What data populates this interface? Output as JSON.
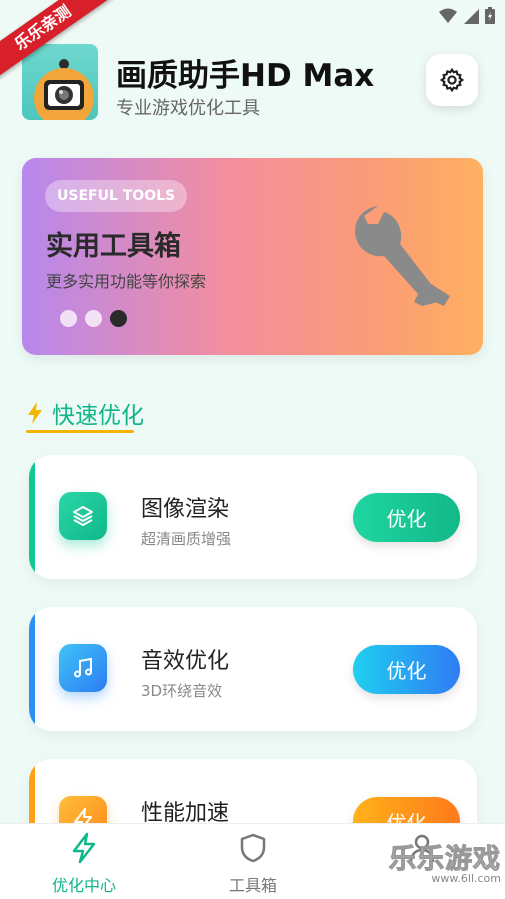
{
  "status_bar": {
    "icons": [
      "wifi-icon",
      "signal-icon",
      "battery-icon"
    ]
  },
  "watermark_ribbon": {
    "text": "乐乐亲测"
  },
  "header": {
    "title": "画质助手HD Max",
    "subtitle": "专业游戏优化工具"
  },
  "banner": {
    "tag": "USEFUL TOOLS",
    "title": "实用工具箱",
    "subtitle": "更多实用功能等你探索",
    "active_dot": 3,
    "dot_count": 3
  },
  "section": {
    "title": "快速优化",
    "accent_color": "#12b58a"
  },
  "cards": [
    {
      "title": "图像渲染",
      "desc": "超清画质增强",
      "button": "优化",
      "accent": "#12c796",
      "icon": "layers-icon"
    },
    {
      "title": "音效优化",
      "desc": "3D环绕音效",
      "button": "优化",
      "accent": "#2d8ff5",
      "icon": "music-note-icon"
    },
    {
      "title": "性能加速",
      "desc": "",
      "button": "优化",
      "accent": "#ff9f1a",
      "icon": "lightning-icon"
    }
  ],
  "bottom_nav": [
    {
      "label": "优化中心",
      "icon": "lightning-icon",
      "active": true
    },
    {
      "label": "工具箱",
      "icon": "shield-icon",
      "active": false
    },
    {
      "label": "",
      "icon": "person-icon",
      "active": false
    }
  ],
  "watermark": {
    "main": "乐乐游戏",
    "url": "www.6ll.com"
  }
}
